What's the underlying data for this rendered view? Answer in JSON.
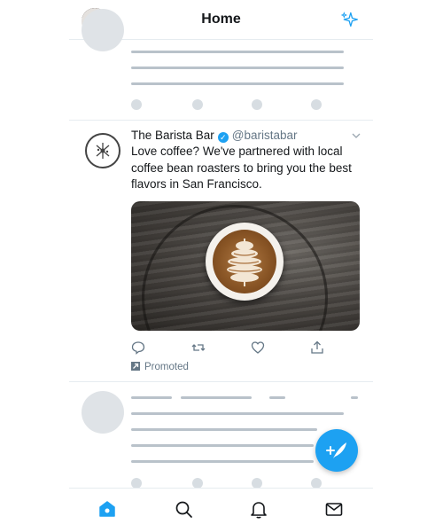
{
  "header": {
    "title": "Home",
    "avatar_icon": "user-avatar",
    "sparkle_icon": "sparkle-icon"
  },
  "tweet": {
    "name": "The Barista Bar",
    "verified_mark": "✓",
    "handle": "@baristabar",
    "text": "Love coffee? We've partnered with local coffee bean roasters to bring you the best flavors in San Francisco.",
    "promoted_label": "Promoted",
    "media_description_icon": "latte-art-image"
  },
  "actions": [
    "reply-icon",
    "retweet-icon",
    "like-icon",
    "share-icon"
  ],
  "bottom_nav": [
    "home-icon",
    "search-icon",
    "notifications-icon",
    "messages-icon"
  ],
  "colors": {
    "accent": "#1da1f2",
    "text": "#14171a",
    "muted": "#657786",
    "divider": "#e6ecf0"
  }
}
